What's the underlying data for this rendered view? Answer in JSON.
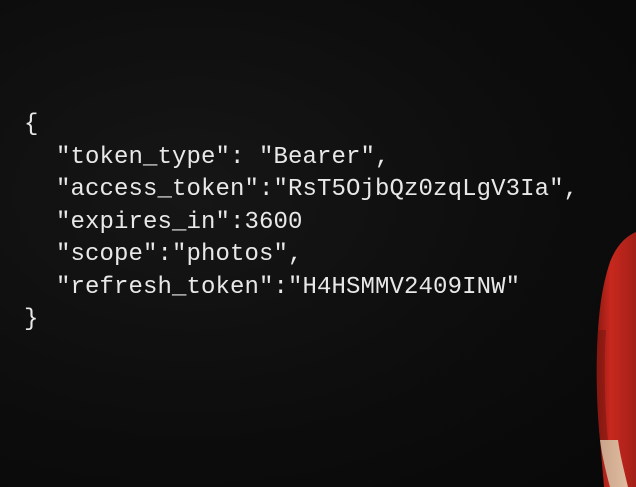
{
  "code": {
    "open_brace": "{",
    "lines": [
      "\"token_type\": \"Bearer\",",
      "\"access_token\":\"RsT5OjbQz0zqLgV3Ia\",",
      "\"expires_in\":3600",
      "\"scope\":\"photos\",",
      "\"refresh_token\":\"H4HSMMV2409INW\""
    ],
    "close_brace": "}"
  },
  "colors": {
    "background": "#0c0c0c",
    "code_text": "#e8e8e8",
    "shirt": "#c8281e"
  },
  "presenter": {
    "icon": "person-figure"
  }
}
